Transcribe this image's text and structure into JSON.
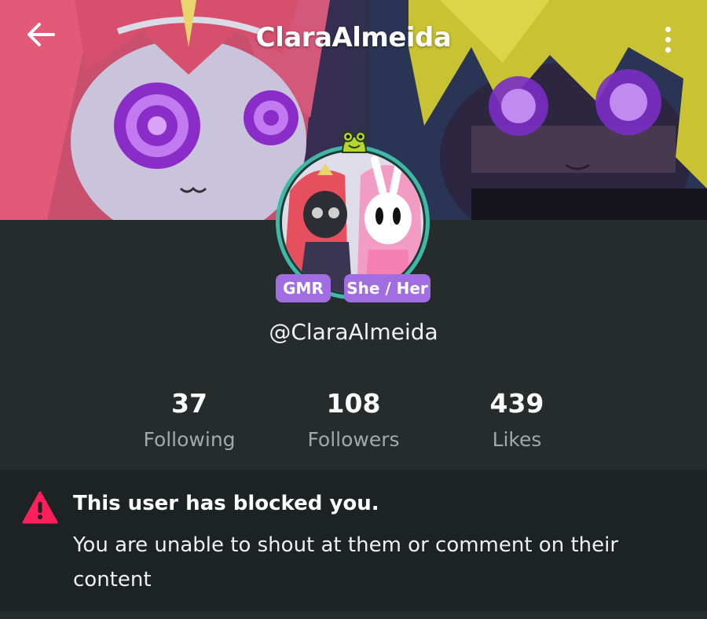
{
  "header": {
    "title": "ClaraAlmeida",
    "back_icon": "arrow-left-icon",
    "menu_icon": "more-vertical-icon"
  },
  "profile": {
    "avatar_frame_icon": "frog-icon",
    "badges": [
      "GMR",
      "She / Her"
    ],
    "handle": "@ClaraAlmeida"
  },
  "stats": [
    {
      "value": "37",
      "label": "Following"
    },
    {
      "value": "108",
      "label": "Followers"
    },
    {
      "value": "439",
      "label": "Likes"
    }
  ],
  "notice": {
    "icon": "warning-triangle-icon",
    "title": "This user has blocked you.",
    "body": "You are unable to shout at them or comment on their content"
  },
  "colors": {
    "background": "#262c2c",
    "notice_background": "#1d2222",
    "badge": "#a06ee0",
    "warning": "#ff1f5a",
    "muted_text": "#a3a8a8",
    "avatar_ring": "#3fb8a8"
  }
}
